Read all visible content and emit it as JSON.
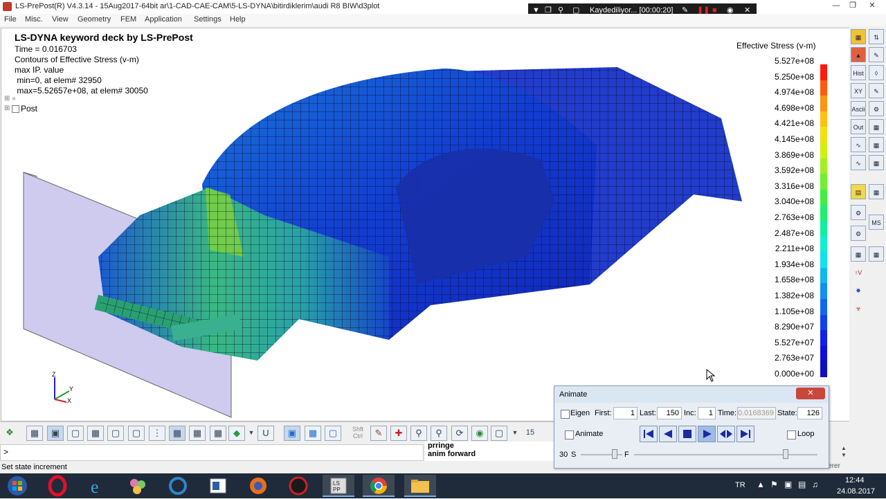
{
  "window": {
    "title": "LS-PrePost(R) V4.3.14 - 15Aug2017-64bit ar\\1-CAD-CAE-CAM\\5-LS-DYNA\\bitirdiklerim\\audi R8 BIW\\d3plot"
  },
  "recorder": {
    "status": "Kaydediliyor... [00:00:20]"
  },
  "menu": [
    "File",
    "Misc.",
    "View",
    "Geometry",
    "FEM",
    "Application",
    "Settings",
    "Help"
  ],
  "viewport": {
    "info": [
      "LS-DYNA keyword deck by LS-PrePost",
      "Time =     0.016703",
      "Contours of Effective Stress (v-m)",
      "max IP. value",
      " min=0, at elem# 32950",
      " max=5.52657e+08, at elem# 30050"
    ],
    "tree_label": "Post",
    "axis": {
      "x": "X",
      "y": "Y",
      "z": "Z"
    }
  },
  "legend": {
    "title": "Effective Stress (v-m)",
    "labels": [
      "5.527e+08",
      "5.250e+08",
      "4.974e+08",
      "4.698e+08",
      "4.421e+08",
      "4.145e+08",
      "3.869e+08",
      "3.592e+08",
      "3.316e+08",
      "3.040e+08",
      "2.763e+08",
      "2.487e+08",
      "2.211e+08",
      "1.934e+08",
      "1.658e+08",
      "1.382e+08",
      "1.105e+08",
      "8.290e+07",
      "5.527e+07",
      "2.763e+07",
      "0.000e+00"
    ],
    "colors": [
      "#ff1a10",
      "#ff5a10",
      "#ff9410",
      "#ffc010",
      "#f2e010",
      "#d0f010",
      "#a0f020",
      "#70f030",
      "#40f040",
      "#20f070",
      "#10f0a0",
      "#10f0d0",
      "#10e0f0",
      "#10b8f0",
      "#1090f0",
      "#1068f0",
      "#1040f0",
      "#1020e8",
      "#1010d8",
      "#1010c0"
    ]
  },
  "bottom_toolbar": {
    "shft_ctrl": "Shft\nCtrl",
    "number": "15"
  },
  "command_log": [
    "prringe",
    "anim forward"
  ],
  "command_prompt": ">",
  "status_text": "Set state increment",
  "status_right": "Fast Renderer",
  "animate": {
    "title": "Animate",
    "eigen_label": "Eigen",
    "first_label": "First:",
    "first": "1",
    "last_label": "Last:",
    "last": "150",
    "inc_label": "Inc:",
    "inc": "1",
    "time_label": "Time:",
    "time": "0.0168369",
    "state_label": "State:",
    "state": "126",
    "animate_label": "Animate",
    "loop_label": "Loop",
    "speed_value": "30",
    "speed_s": "S",
    "speed_f": "F"
  },
  "taskbar": {
    "lang": "TR",
    "time": "12:44",
    "date": "24.08.2017"
  }
}
